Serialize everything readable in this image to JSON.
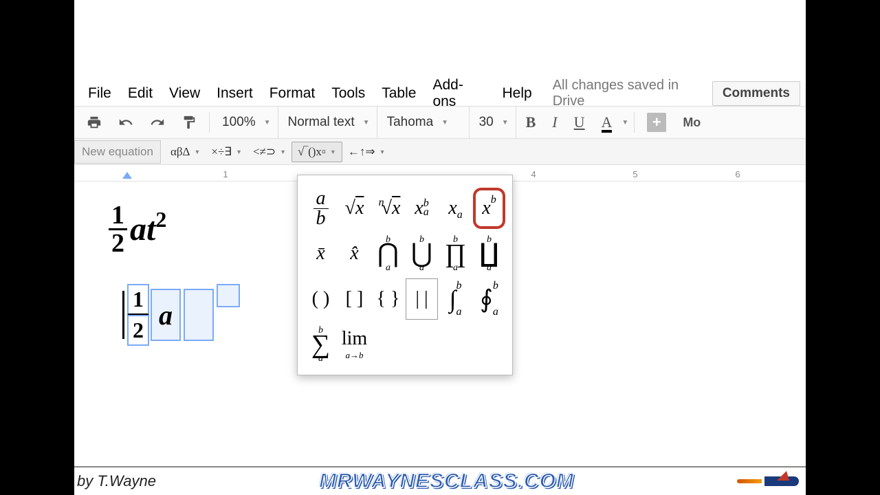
{
  "menubar": {
    "items": [
      "File",
      "Edit",
      "View",
      "Insert",
      "Format",
      "Tools",
      "Table",
      "Add-ons",
      "Help"
    ],
    "savestatus": "All changes saved in Drive",
    "comments": "Comments"
  },
  "toolbar": {
    "zoom": "100%",
    "style": "Normal text",
    "font": "Tahoma",
    "size": "30",
    "more": "Mo"
  },
  "eqbar": {
    "new": "New equation",
    "groups": {
      "greek": "αβΔ",
      "ops": "×÷∃",
      "rel": "<≠⊃",
      "math": "√‾()x▫",
      "arrows": "←↑⇒"
    }
  },
  "ruler": {
    "nums": [
      "1",
      "5",
      "6"
    ],
    "num4": "4"
  },
  "doc": {
    "formula1": {
      "num": "1",
      "den": "2",
      "a": "a",
      "t": "t",
      "exp": "2"
    },
    "editing": {
      "num": "1",
      "den": "2",
      "a": "a"
    }
  },
  "mathpanel": {
    "r1": {
      "frac_a": "a",
      "frac_b": "b",
      "sqrt": "√",
      "sqrt_x": "x",
      "nroot_n": "n",
      "nroot_x": "x",
      "subsup_x": "x",
      "subsup_a": "a",
      "subsup_b": "b",
      "sub_x": "x",
      "sub_a": "a",
      "sup_x": "x",
      "sup_b": "b"
    },
    "r2": {
      "bar_x": "x̄",
      "hat_x": "x̂",
      "cap": "⋂",
      "cup": "⋃",
      "prod": "∏",
      "coprod": "∐",
      "a": "a",
      "b": "b"
    },
    "r3": {
      "paren": "( )",
      "brack": "[ ]",
      "brace": "{ }",
      "abs": "| |",
      "int": "∫",
      "oint": "∮",
      "a": "a",
      "b": "b"
    },
    "r4": {
      "sum": "∑",
      "a": "a",
      "b": "b",
      "lim": "lim",
      "lim_sub": "a→b"
    }
  },
  "footer": {
    "byline": "by T.Wayne",
    "site": "MRWAYNESCLASS.COM"
  }
}
